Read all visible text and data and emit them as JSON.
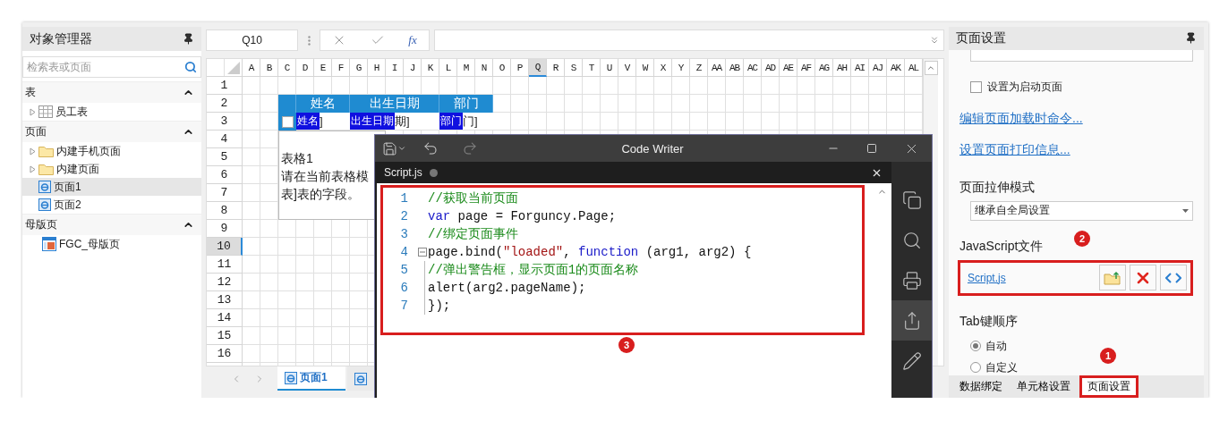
{
  "object_manager": {
    "title": "对象管理器",
    "search": {
      "placeholder": "检索表或页面"
    },
    "sections": [
      {
        "title": "表",
        "expanded": true,
        "items": [
          {
            "label": "员工表",
            "kind": "table",
            "selected": false
          }
        ]
      },
      {
        "title": "页面",
        "expanded": true,
        "items": [
          {
            "label": "内建手机页面",
            "kind": "folder",
            "selected": false
          },
          {
            "label": "内建页面",
            "kind": "folder",
            "selected": false
          },
          {
            "label": "页面1",
            "kind": "page",
            "selected": true
          },
          {
            "label": "页面2",
            "kind": "page",
            "selected": false
          }
        ]
      },
      {
        "title": "母版页",
        "expanded": true,
        "items": [
          {
            "label": "FGC_母版页",
            "kind": "master",
            "selected": false
          }
        ]
      }
    ]
  },
  "formula_bar": {
    "cell_name": "Q10",
    "function_label": "fx"
  },
  "sheet": {
    "columns": [
      {
        "label": "A",
        "selected": false
      },
      {
        "label": "B",
        "selected": false
      },
      {
        "label": "C",
        "selected": false
      },
      {
        "label": "D",
        "selected": false
      },
      {
        "label": "E",
        "selected": false
      },
      {
        "label": "F",
        "selected": false
      },
      {
        "label": "G",
        "selected": false
      },
      {
        "label": "H",
        "selected": false
      },
      {
        "label": "I",
        "selected": false
      },
      {
        "label": "J",
        "selected": false
      },
      {
        "label": "K",
        "selected": false
      },
      {
        "label": "L",
        "selected": false
      },
      {
        "label": "M",
        "selected": false
      },
      {
        "label": "N",
        "selected": false
      },
      {
        "label": "O",
        "selected": false
      },
      {
        "label": "P",
        "selected": false
      },
      {
        "label": "Q",
        "selected": true
      },
      {
        "label": "R",
        "selected": false
      },
      {
        "label": "S",
        "selected": false
      },
      {
        "label": "T",
        "selected": false
      },
      {
        "label": "U",
        "selected": false
      },
      {
        "label": "V",
        "selected": false
      },
      {
        "label": "W",
        "selected": false
      },
      {
        "label": "X",
        "selected": false
      },
      {
        "label": "Y",
        "selected": false
      },
      {
        "label": "Z",
        "selected": false
      },
      {
        "label": "AA",
        "selected": false
      },
      {
        "label": "AB",
        "selected": false
      },
      {
        "label": "AC",
        "selected": false
      },
      {
        "label": "AD",
        "selected": false
      },
      {
        "label": "AE",
        "selected": false
      },
      {
        "label": "AF",
        "selected": false
      },
      {
        "label": "AG",
        "selected": false
      },
      {
        "label": "AH",
        "selected": false
      },
      {
        "label": "AI",
        "selected": false
      },
      {
        "label": "AJ",
        "selected": false
      },
      {
        "label": "AK",
        "selected": false
      },
      {
        "label": "AL",
        "selected": false
      }
    ],
    "rows": [
      {
        "label": "1",
        "selected": false
      },
      {
        "label": "2",
        "selected": false
      },
      {
        "label": "3",
        "selected": false
      },
      {
        "label": "4",
        "selected": false
      },
      {
        "label": "5",
        "selected": false
      },
      {
        "label": "6",
        "selected": false
      },
      {
        "label": "7",
        "selected": false
      },
      {
        "label": "8",
        "selected": false
      },
      {
        "label": "9",
        "selected": false
      },
      {
        "label": "10",
        "selected": true
      },
      {
        "label": "11",
        "selected": false
      },
      {
        "label": "12",
        "selected": false
      },
      {
        "label": "13",
        "selected": false
      },
      {
        "label": "14",
        "selected": false
      },
      {
        "label": "15",
        "selected": false
      },
      {
        "label": "16",
        "selected": false
      }
    ],
    "cells": [
      {
        "kind": "header"
      },
      {
        "kind": "header",
        "text": "姓名"
      },
      {
        "kind": "header",
        "text": "出生日期"
      },
      {
        "kind": "header",
        "text": "部门"
      },
      {
        "kind": "checkbox",
        "checked": false
      },
      {
        "kind": "field",
        "label": "姓名",
        "text": "]"
      },
      {
        "kind": "field",
        "label": "出生日期",
        "text": "期]"
      },
      {
        "kind": "field",
        "label": "部门",
        "text": "门]"
      },
      {
        "kind": "note",
        "lines": [
          "表格1",
          "请在当前表格模",
          "表]表的字段。"
        ]
      }
    ],
    "tabs": [
      {
        "label": "页面1",
        "selected": true
      },
      {
        "selected": false
      }
    ]
  },
  "code_writer": {
    "title": "Code Writer",
    "tab": {
      "label": "Script.js",
      "modified": true
    },
    "callout": "3",
    "lines": [
      {
        "number": "1",
        "fold": false,
        "tokens": [
          {
            "text": "//获取当前页面",
            "kind": "comment"
          }
        ]
      },
      {
        "number": "2",
        "fold": false,
        "tokens": [
          {
            "text": "var",
            "kind": "keyword"
          },
          {
            "text": " page = Forguncy.Page;",
            "kind": "plain"
          }
        ]
      },
      {
        "number": "3",
        "fold": false,
        "tokens": [
          {
            "text": "//绑定页面事件",
            "kind": "comment"
          }
        ]
      },
      {
        "number": "4",
        "fold": true,
        "tokens": [
          {
            "text": "page.bind(",
            "kind": "plain"
          },
          {
            "text": "\"loaded\"",
            "kind": "string"
          },
          {
            "text": ", ",
            "kind": "plain"
          },
          {
            "text": "function",
            "kind": "keyword"
          },
          {
            "text": " (arg1, arg2) {",
            "kind": "plain"
          }
        ]
      },
      {
        "number": "5",
        "fold": false,
        "tokens": [
          {
            "text": "//弹出警告框，显示页面1的页面名称",
            "kind": "comment"
          }
        ]
      },
      {
        "number": "6",
        "fold": false,
        "tokens": [
          {
            "text": "alert(arg2.pageName);",
            "kind": "plain"
          }
        ]
      },
      {
        "number": "7",
        "fold": false,
        "tokens": [
          {
            "text": "});",
            "kind": "plain"
          }
        ]
      }
    ],
    "tools": [
      {
        "kind": "copy",
        "highlighted": false
      },
      {
        "kind": "search",
        "highlighted": false
      },
      {
        "kind": "print",
        "highlighted": false
      },
      {
        "kind": "share",
        "highlighted": true
      },
      {
        "kind": "edit",
        "highlighted": false
      }
    ]
  },
  "page_settings": {
    "title": "页面设置",
    "startup_checkbox": {
      "label": "设置为启动页面",
      "checked": false
    },
    "links": [
      "编辑页面加载时命令...",
      "设置页面打印信息..."
    ],
    "stretch_mode": {
      "label": "页面拉伸模式",
      "value": "继承自全局设置"
    },
    "javascript": {
      "label": "JavaScript文件",
      "callout": "2",
      "file": "Script.js"
    },
    "tab_order": {
      "label": "Tab键顺序",
      "options": [
        {
          "label": "自动",
          "selected": true
        },
        {
          "label": "自定义",
          "selected": false
        }
      ]
    },
    "bottom_tabs": [
      {
        "label": "数据绑定",
        "selected": false
      },
      {
        "label": "单元格设置",
        "selected": false
      },
      {
        "label": "页面设置",
        "selected": true,
        "callout": "1"
      }
    ]
  }
}
